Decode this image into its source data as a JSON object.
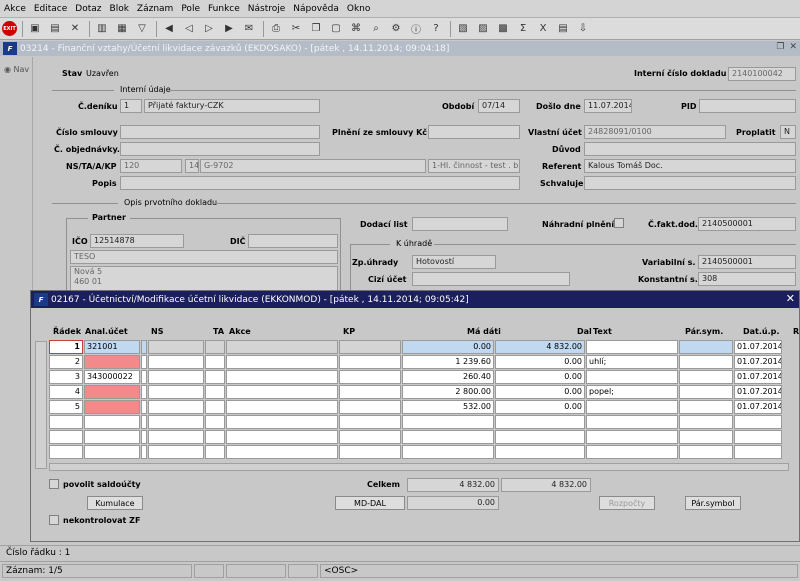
{
  "menu": [
    "Akce",
    "Editace",
    "Dotaz",
    "Blok",
    "Záznam",
    "Pole",
    "Funkce",
    "Nástroje",
    "Nápověda",
    "Okno"
  ],
  "toolbar": {
    "exit_label": "EXIT"
  },
  "main_window": {
    "title": "03214 - Finanční vztahy/Účetní likvidace závazků (EKDOSAKO) - [pátek , 14.11.2014; 09:04:18]",
    "logo": "F"
  },
  "nav": {
    "label": "Nav"
  },
  "form": {
    "stav_label": "Stav",
    "stav_value": "Uzavřen",
    "interni_cislo_label": "Interní číslo dokladu",
    "interni_cislo_value": "2140100042",
    "section_interni": "Interní údaje",
    "c_deniku_label": "Č.deníku",
    "c_deniku_value": "1",
    "denik_name": "Přijaté faktury-CZK",
    "obdobi_label": "Období",
    "obdobi_value": "07/14",
    "doslo_dne_label": "Došlo dne",
    "doslo_dne_value": "11.07.2014",
    "pid_label": "PID",
    "pid_value": "",
    "cislo_smlouvy_label": "Číslo smlouvy",
    "cislo_smlouvy_value": "",
    "plneni_label": "Plnění ze smlouvy Kč",
    "plneni_value": "",
    "vlastni_ucet_label": "Vlastní účet",
    "vlastni_ucet_value": "24828091/0100",
    "proplatit_label": "Proplatit",
    "proplatit_value": "N",
    "c_objednavky_label": "Č. objednávky.",
    "c_objednavky_value": "",
    "duvod_label": "Důvod",
    "duvod_value": "",
    "ns_label": "NS/TA/A/KP",
    "ns_value": "120",
    "ta_value": "14",
    "a_value": "G-9702",
    "kp_value": "1-Hl. činnost - test . bbb",
    "referent_label": "Referent",
    "referent_value": "Kalous Tomáš Doc.",
    "popis_label": "Popis",
    "popis_value": "",
    "schvaluje_label": "Schvaluje",
    "schvaluje_value": "",
    "section_opis": "Opis prvotního dokladu",
    "partner_label": "Partner",
    "ico_label": "IČO",
    "ico_value": "12514878",
    "dic_label": "DIČ",
    "dic_value": "",
    "partner_name": "TESO",
    "partner_addr1": "Nová 5",
    "partner_addr2": "460 01",
    "dodaci_list_label": "Dodací list",
    "dodaci_list_value": "",
    "nahradni_plneni_label": "Náhradní plnění",
    "c_fakt_dod_label": "Č.fakt.dod.",
    "c_fakt_dod_value": "2140500001",
    "k_uhrade_label": "K úhradě",
    "zp_uhrady_label": "Zp.úhrady",
    "zp_uhrady_value": "Hotovostí",
    "variabilni_label": "Variabilní s.",
    "variabilni_value": "2140500001",
    "cizi_ucet_label": "Cizí účet",
    "cizi_ucet_value": "",
    "konstantni_label": "Konstantní s.",
    "konstantni_value": "308"
  },
  "dialog": {
    "title": "02167 - Účetnictví/Modifikace účetní likvidace (EKKONMOD) - [pátek , 14.11.2014; 09:05:42]",
    "logo": "F",
    "headers": {
      "radek": "Řádek",
      "anal_ucet": "Anal.účet",
      "ns": "NS",
      "ta": "TA",
      "akce": "Akce",
      "kp": "KP",
      "ma_dati": "Má dáti",
      "dal": "Dal",
      "text": "Text",
      "par_sym": "Pár.sym.",
      "dat_up": "Dat.ú.p.",
      "r": "R"
    },
    "rows": [
      {
        "radek": "1",
        "ucet": "321001",
        "ma_dati": "0.00",
        "dal": "4 832.00",
        "text": "",
        "par_sym": "",
        "dat": "01.07.2014",
        "state": "blue"
      },
      {
        "radek": "2",
        "ucet": "",
        "ma_dati": "1 239.60",
        "dal": "0.00",
        "text": "uhlí;",
        "par_sym": "",
        "dat": "01.07.2014",
        "state": "red"
      },
      {
        "radek": "3",
        "ucet": "343000022",
        "ma_dati": "260.40",
        "dal": "0.00",
        "text": "",
        "par_sym": "",
        "dat": "01.07.2014",
        "state": "normal"
      },
      {
        "radek": "4",
        "ucet": "",
        "ma_dati": "2 800.00",
        "dal": "0.00",
        "text": "popel;",
        "par_sym": "",
        "dat": "01.07.2014",
        "state": "red"
      },
      {
        "radek": "5",
        "ucet": "",
        "ma_dati": "532.00",
        "dal": "0.00",
        "text": "",
        "par_sym": "",
        "dat": "01.07.2014",
        "state": "red"
      }
    ],
    "povolit_saldo_label": "povolit saldoúčty",
    "celkem_label": "Celkem",
    "celkem_md": "4 832.00",
    "celkem_dal": "4 832.00",
    "kumulace_label": "Kumulace",
    "md_dal_label": "MD-DAL",
    "md_dal_value": "0.00",
    "rozpocty_label": "Rozpočty",
    "par_symbol_label": "Pár.symbol",
    "nekontrolovat_label": "nekontrolovat ZF"
  },
  "status": {
    "cislo_radku": "Číslo řádku : 1",
    "zaznam": "Záznam: 1/5",
    "osc": "<OSC>"
  }
}
